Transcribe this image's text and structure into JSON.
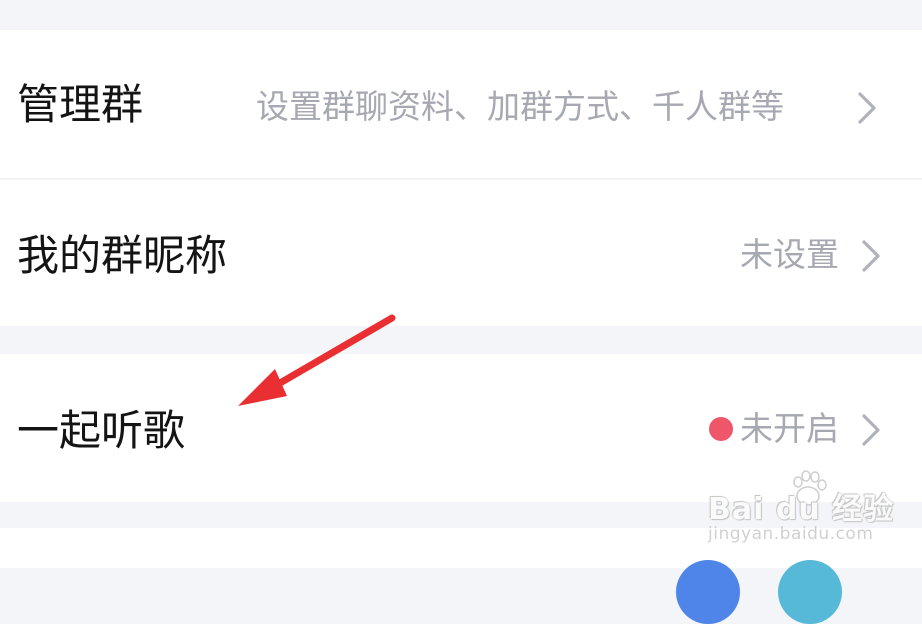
{
  "settings": {
    "manage_group": {
      "title": "管理群",
      "value": "设置群聊资料、加群方式、千人群等"
    },
    "my_nickname": {
      "title": "我的群昵称",
      "value": "未设置"
    },
    "listen_together": {
      "title": "一起听歌",
      "value": "未开启"
    }
  },
  "watermark": {
    "brand": "Bai du 经验",
    "url": "jingyan.baidu.com"
  },
  "icons": {
    "row_chevron": "chevron-right-icon",
    "status_dot": "red-dot-icon",
    "annotation": "red-arrow"
  },
  "colors": {
    "background": "#f4f5f9",
    "row": "#ffffff",
    "title_text": "#141414",
    "value_text": "#a6a9b2",
    "status_dot": "#f0566a",
    "annotation_arrow": "#ea2f33"
  }
}
